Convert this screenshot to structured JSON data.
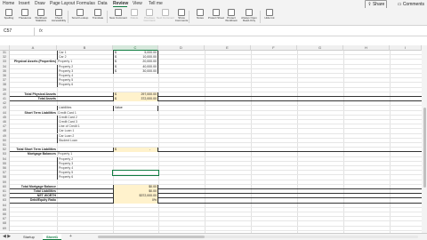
{
  "menu": {
    "tabs": [
      "Home",
      "Insert",
      "Draw",
      "Page Layout",
      "Formulas",
      "Data",
      "Review",
      "View",
      "Tell me"
    ],
    "active": "Review",
    "share": "Share",
    "comments": "Comments"
  },
  "ribbon": {
    "buttons": [
      "Spelling",
      "Thesaurus",
      "Workbook Statistics",
      "Check Accessibility",
      "Smart Lookup",
      "Translate",
      "New Comment",
      "Delete",
      "Previous Comment",
      "Next Comment",
      "Show Comments",
      "Notes",
      "Protect Sheet",
      "Protect Workbook",
      "Always Open Read-Only",
      "Hide Ink"
    ]
  },
  "formula_bar": {
    "name_box": "C57",
    "fx": "fx",
    "content": ""
  },
  "columns": [
    "A",
    "B",
    "C",
    "D",
    "E",
    "F",
    "G",
    "H",
    "I",
    "J",
    "K"
  ],
  "selected_column": "C",
  "rows": [
    {
      "num": "31",
      "a": "",
      "b": "Car 1",
      "c_sym": "$",
      "c_val": "5,000.00",
      "yellow": false,
      "sym": true
    },
    {
      "num": "32",
      "a": "",
      "b": "Car 2",
      "c_sym": "$",
      "c_val": "10,000.00",
      "yellow": false,
      "sym": true
    },
    {
      "num": "33",
      "a": "Physical Assets (Properties)",
      "b": "Property 1",
      "c_sym": "$",
      "c_val": "20,000.00",
      "yellow": false,
      "sym": true
    },
    {
      "num": "34",
      "a": "",
      "b": "Property 2",
      "c_sym": "$",
      "c_val": "40,000.00",
      "yellow": false,
      "sym": true
    },
    {
      "num": "35",
      "a": "",
      "b": "Property 3",
      "c_sym": "$",
      "c_val": "30,000.00",
      "yellow": false,
      "sym": true
    },
    {
      "num": "36",
      "a": "",
      "b": "Property 4",
      "c_sym": "",
      "c_val": "",
      "yellow": false,
      "sym": true
    },
    {
      "num": "37",
      "a": "",
      "b": "Property 5",
      "c_sym": "",
      "c_val": "",
      "yellow": false,
      "sym": true
    },
    {
      "num": "38",
      "a": "",
      "b": "Property 6",
      "c_sym": "",
      "c_val": "",
      "yellow": false,
      "sym": true
    },
    {
      "num": "39",
      "a": "",
      "b": "",
      "c_sym": "",
      "c_val": "",
      "yellow": false,
      "sym": false
    },
    {
      "num": "40",
      "a": "Total Physical Assets",
      "b": "",
      "c_sym": "$",
      "c_val": "297,000.00",
      "yellow": true,
      "sym": true
    },
    {
      "num": "41",
      "a": "Total Assets",
      "b": "",
      "c_sym": "$",
      "c_val": "372,000.00",
      "yellow": true,
      "sym": true
    },
    {
      "num": "42",
      "a": "",
      "b": "",
      "c_sym": "",
      "c_val": "",
      "yellow": false,
      "sym": false
    },
    {
      "num": "43",
      "a": "",
      "b": "Liabilities",
      "c_sym": "",
      "c_val": "Value",
      "yellow": false,
      "sym": false
    },
    {
      "num": "44",
      "a": "Short Term Liabilities",
      "b": "Credit Card 1",
      "c_sym": "",
      "c_val": "",
      "yellow": false,
      "sym": false
    },
    {
      "num": "45",
      "a": "",
      "b": "Credit Card 2",
      "c_sym": "",
      "c_val": "",
      "yellow": false,
      "sym": false
    },
    {
      "num": "46",
      "a": "",
      "b": "Credit Card 3",
      "c_sym": "",
      "c_val": "",
      "yellow": false,
      "sym": false
    },
    {
      "num": "47",
      "a": "",
      "b": "Line of Credit 1",
      "c_sym": "",
      "c_val": "",
      "yellow": false,
      "sym": false
    },
    {
      "num": "48",
      "a": "",
      "b": "Car Loan 1",
      "c_sym": "",
      "c_val": "",
      "yellow": false,
      "sym": false
    },
    {
      "num": "49",
      "a": "",
      "b": "Car Loan 2",
      "c_sym": "",
      "c_val": "",
      "yellow": false,
      "sym": false
    },
    {
      "num": "50",
      "a": "",
      "b": "Student Loan",
      "c_sym": "",
      "c_val": "",
      "yellow": false,
      "sym": false
    },
    {
      "num": "51",
      "a": "",
      "b": "",
      "c_sym": "",
      "c_val": "",
      "yellow": false,
      "sym": false
    },
    {
      "num": "52",
      "a": "Total Short Term Liabilities",
      "b": "",
      "c_sym": "$",
      "c_val": "-",
      "yellow": true,
      "sym": true
    },
    {
      "num": "53",
      "a": "Mortgage Balances",
      "b": "Property 1",
      "c_sym": "",
      "c_val": "",
      "yellow": false,
      "sym": false
    },
    {
      "num": "54",
      "a": "",
      "b": "Property 2",
      "c_sym": "",
      "c_val": "",
      "yellow": false,
      "sym": false
    },
    {
      "num": "55",
      "a": "",
      "b": "Property 3",
      "c_sym": "",
      "c_val": "",
      "yellow": false,
      "sym": false
    },
    {
      "num": "56",
      "a": "",
      "b": "Property 4",
      "c_sym": "",
      "c_val": "",
      "yellow": false,
      "sym": false
    },
    {
      "num": "57",
      "a": "",
      "b": "Property 5",
      "c_sym": "",
      "c_val": "",
      "yellow": false,
      "sym": false
    },
    {
      "num": "58",
      "a": "",
      "b": "Property 6",
      "c_sym": "",
      "c_val": "",
      "yellow": false,
      "sym": false
    },
    {
      "num": "59",
      "a": "",
      "b": "",
      "c_sym": "",
      "c_val": "",
      "yellow": false,
      "sym": false
    },
    {
      "num": "60",
      "a": "Total Mortgage Balance",
      "b": "",
      "c_sym": "",
      "c_val": "$0.00",
      "yellow": true,
      "sym": false
    },
    {
      "num": "61",
      "a": "Total Liabilities",
      "b": "",
      "c_sym": "",
      "c_val": "$0.00",
      "yellow": true,
      "sym": false
    },
    {
      "num": "62",
      "a": "NET WORTH",
      "b": "",
      "c_sym": "",
      "c_val": "$372,000.00",
      "yellow": true,
      "sym": false
    },
    {
      "num": "63",
      "a": "Debt/Equity Ratio",
      "b": "",
      "c_sym": "",
      "c_val": "0%",
      "yellow": true,
      "sym": false
    },
    {
      "num": "64",
      "a": "",
      "b": "",
      "c_sym": "",
      "c_val": "",
      "yellow": false,
      "sym": false
    },
    {
      "num": "65",
      "a": "",
      "b": "",
      "c_sym": "",
      "c_val": "",
      "yellow": false,
      "sym": false
    },
    {
      "num": "66",
      "a": "",
      "b": "",
      "c_sym": "",
      "c_val": "",
      "yellow": false,
      "sym": false
    },
    {
      "num": "67",
      "a": "",
      "b": "",
      "c_sym": "",
      "c_val": "",
      "yellow": false,
      "sym": false
    },
    {
      "num": "68",
      "a": "",
      "b": "",
      "c_sym": "",
      "c_val": "",
      "yellow": false,
      "sym": false
    },
    {
      "num": "69",
      "a": "",
      "b": "",
      "c_sym": "",
      "c_val": "",
      "yellow": false,
      "sym": false
    }
  ],
  "sheets": [
    "Startup",
    "Sheet1"
  ],
  "active_sheet": "Sheet1",
  "add_sheet": "+",
  "accent": "#107c41"
}
